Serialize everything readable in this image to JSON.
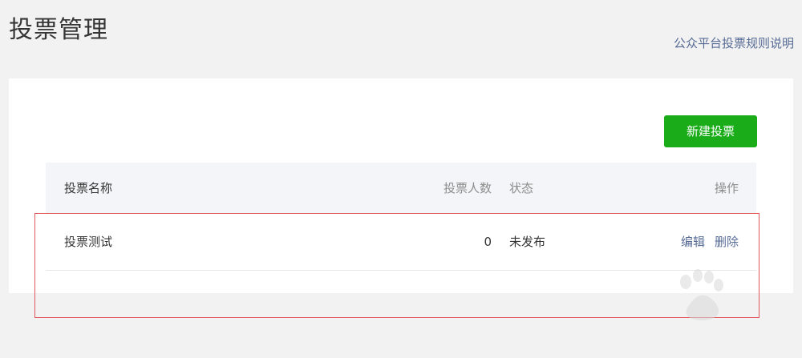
{
  "header": {
    "title": "投票管理",
    "rules_link": "公众平台投票规则说明"
  },
  "toolbar": {
    "new_vote_label": "新建投票"
  },
  "table": {
    "columns": {
      "name": "投票名称",
      "count": "投票人数",
      "status": "状态",
      "operations": "操作"
    },
    "rows": [
      {
        "name": "投票测试",
        "count": "0",
        "status": "未发布",
        "edit_label": "编辑",
        "delete_label": "删除"
      }
    ]
  },
  "colors": {
    "accent_green": "#1aad19",
    "link_blue": "#576b95",
    "highlight_red": "#e0575b"
  }
}
